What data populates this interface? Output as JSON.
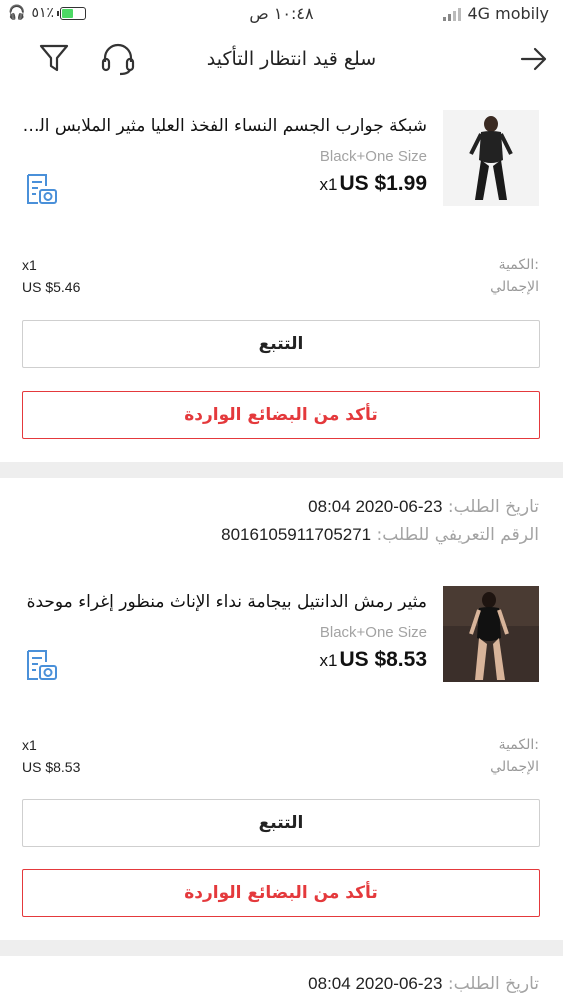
{
  "status_bar": {
    "carrier": "4G mobily",
    "time": "١٠:٤٨ ص",
    "battery": "٥١٪"
  },
  "nav": {
    "title": "سلع قيد انتظار التأكيد"
  },
  "orders": [
    {
      "product_title": "شبكة جوارب الجسم النساء الفخذ العليا مثير الملابس الداخلية",
      "variant": "Black+One Size",
      "qty_prefix": "x1",
      "price": "US $1.99",
      "qty_label": "الكمية:",
      "qty_value": "x1",
      "total_label": "الإجمالي",
      "total_value": "US $5.46",
      "track_label": "التتبع",
      "confirm_label": "تأكد من البضائع الواردة"
    },
    {
      "order_date_label": "تاريخ الطلب:",
      "order_date": "23-06-2020 08:04",
      "order_id_label": "الرقم التعريفي للطلب:",
      "order_id": "8016105911705271",
      "product_title": "مثير رمش الدانتيل بيجامة نداء الإناث منظور إغراء موحدة",
      "variant": "Black+One Size",
      "qty_prefix": "x1",
      "price": "US $8.53",
      "qty_label": "الكمية:",
      "qty_value": "x1",
      "total_label": "الإجمالي",
      "total_value": "US $8.53",
      "track_label": "التتبع",
      "confirm_label": "تأكد من البضائع الواردة"
    },
    {
      "order_date_label": "تاريخ الطلب:",
      "order_date": "23-06-2020 08:04"
    }
  ],
  "colors": {
    "accent_red": "#e4393c",
    "separator_gray": "#eeeeee",
    "muted_text": "#a3a3a3",
    "icon_blue": "#4a90d9"
  },
  "icons": {
    "back": "arrow-right-icon",
    "filter": "funnel-icon",
    "service": "headset-icon",
    "snapshot": "document-camera-icon"
  }
}
